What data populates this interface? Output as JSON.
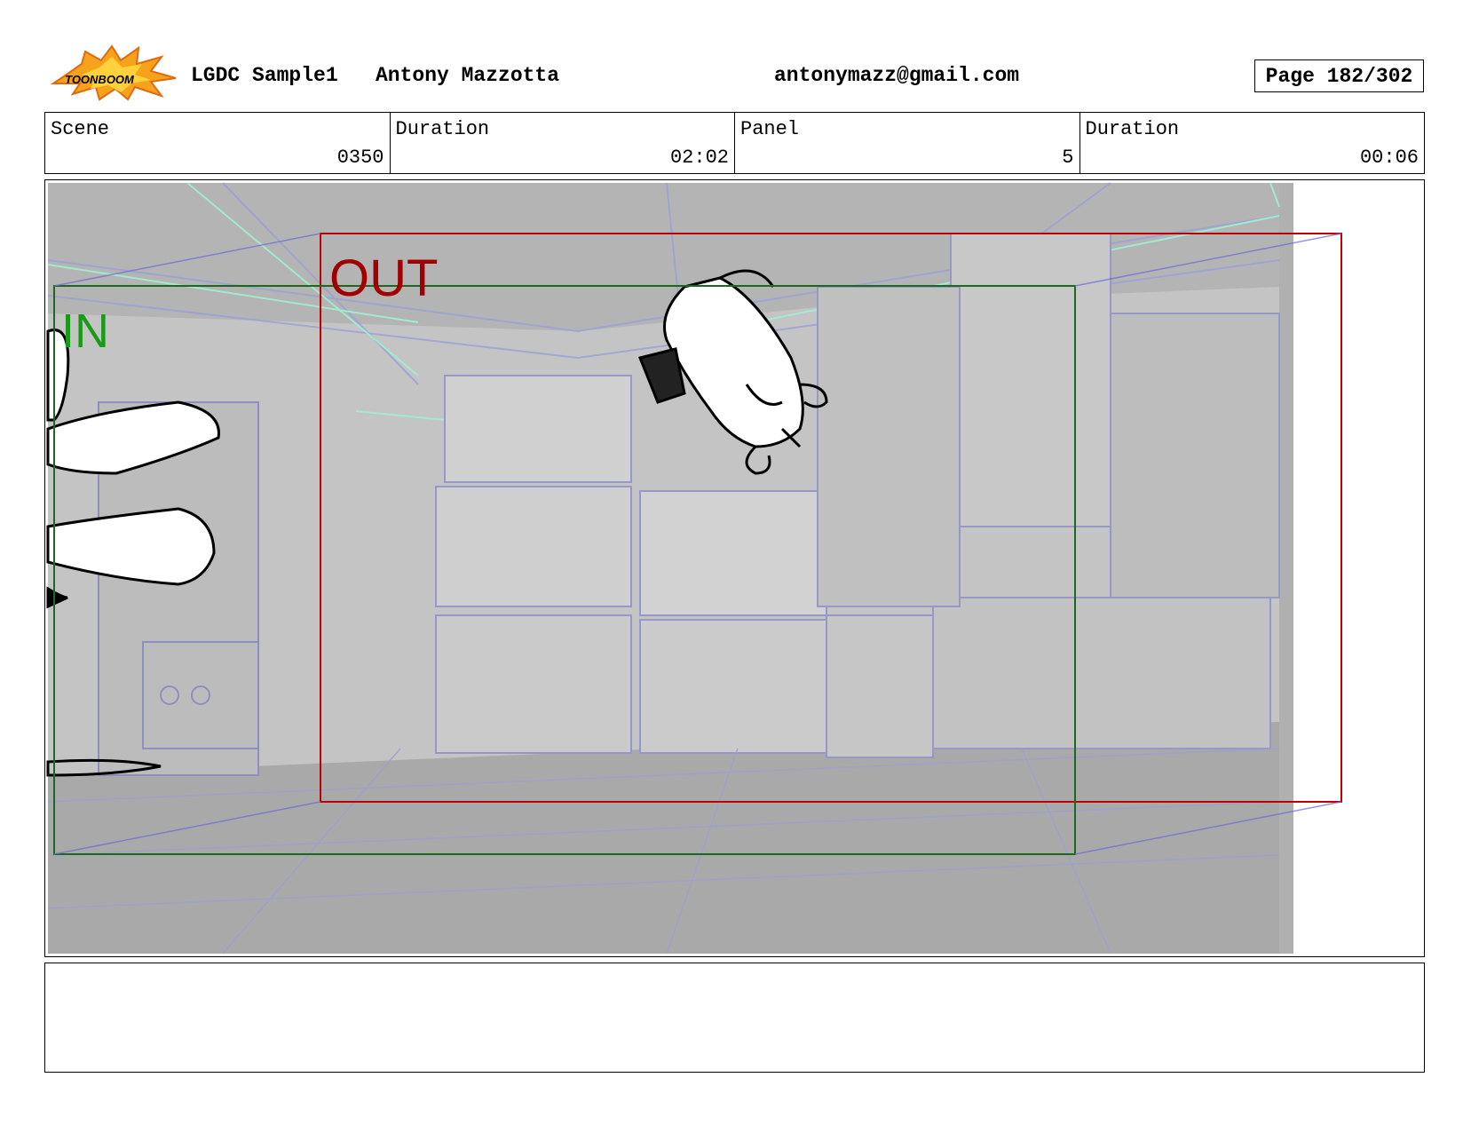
{
  "header": {
    "logo_text": "TOONBOOM",
    "project": "LGDC Sample1",
    "author": "Antony Mazzotta",
    "email": "antonymazz@gmail.com",
    "page": "Page 182/302"
  },
  "info": {
    "scene_label": "Scene",
    "scene_value": "0350",
    "scene_duration_label": "Duration",
    "scene_duration_value": "02:02",
    "panel_label": "Panel",
    "panel_value": "5",
    "panel_duration_label": "Duration",
    "panel_duration_value": "00:06"
  },
  "panel_image": {
    "in_label": "IN",
    "out_label": "OUT",
    "in_color": "#1a9a1a",
    "out_color": "#a00000"
  },
  "notes": {
    "text": ""
  }
}
